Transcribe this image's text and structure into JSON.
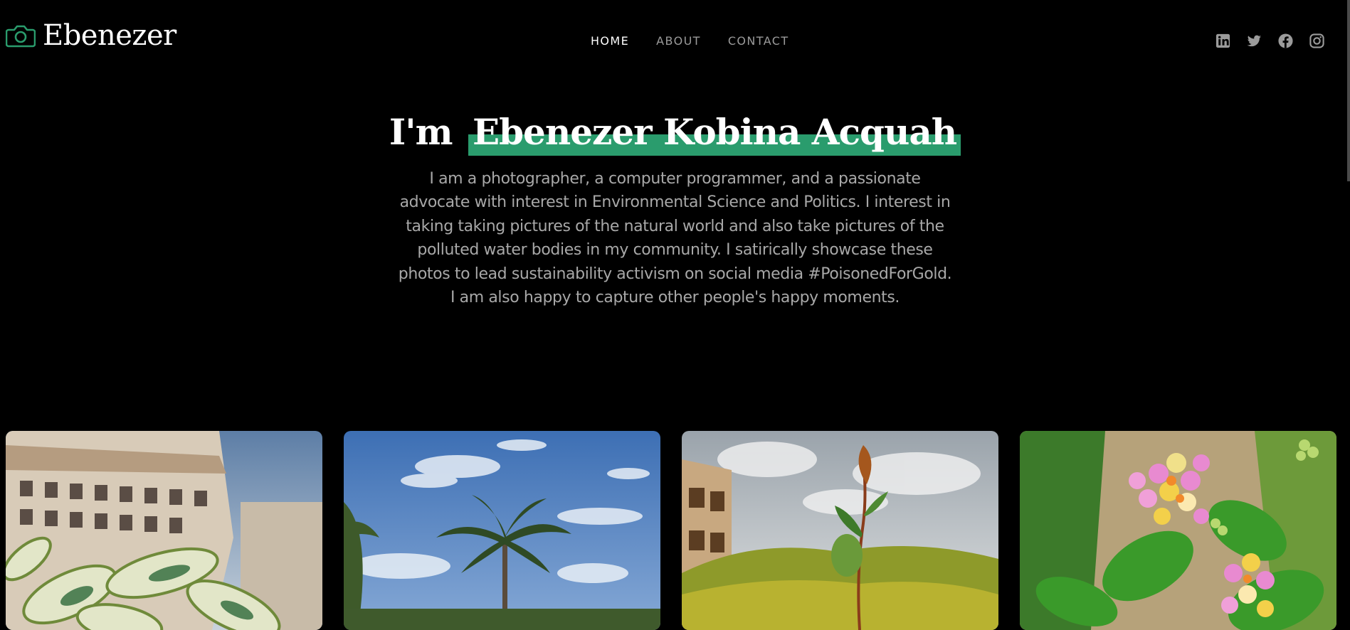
{
  "brand": {
    "name": "Ebenezer",
    "icon": "camera-icon",
    "accent": "#2a9c6d"
  },
  "nav": {
    "items": [
      {
        "label": "HOME",
        "active": true
      },
      {
        "label": "ABOUT",
        "active": false
      },
      {
        "label": "CONTACT",
        "active": false
      }
    ]
  },
  "social": {
    "icons": [
      "linkedin-icon",
      "twitter-icon",
      "facebook-icon",
      "instagram-icon"
    ],
    "color": "#9b9b9b"
  },
  "hero": {
    "prefix": "I'm",
    "name": "Ebenezer Kobina Acquah",
    "highlight_color": "#2a9c6d",
    "description": "I am a photographer, a computer programmer, and a passionate advocate with interest in Environmental Science and Politics. I interest in taking taking pictures of the natural world and also take pictures of the polluted water bodies in my community. I satirically showcase these photos to lead sustainability activism on social media #PoisonedForGold. I am also happy to capture other people's happy moments."
  },
  "gallery": {
    "photos": [
      {
        "subject": "variegated leaves in front of apartment building"
      },
      {
        "subject": "palm trees under blue sky"
      },
      {
        "subject": "young plant shoot by a building"
      },
      {
        "subject": "pink and yellow lantana flowers"
      }
    ]
  }
}
